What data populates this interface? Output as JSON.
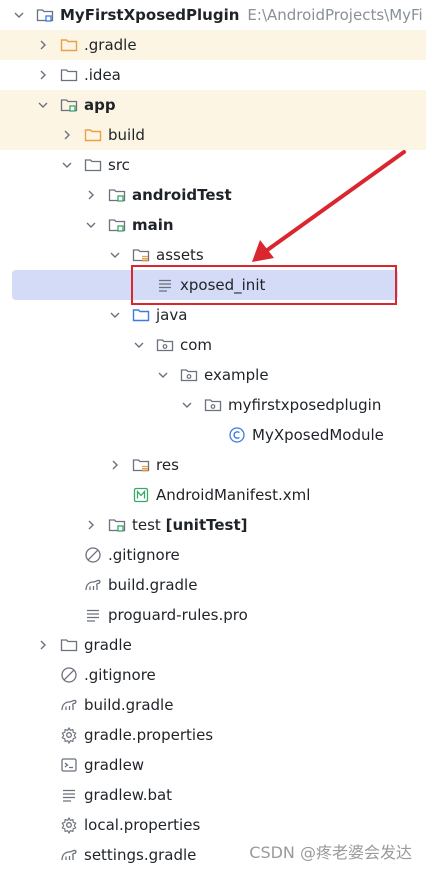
{
  "project": {
    "name": "MyFirstXposedPlugin",
    "path": "E:\\AndroidProjects\\MyFi"
  },
  "nodes": [
    {
      "key": "gradle_dir",
      "label": ".gradle"
    },
    {
      "key": "idea",
      "label": ".idea"
    },
    {
      "key": "app",
      "label": "app"
    },
    {
      "key": "build",
      "label": "build"
    },
    {
      "key": "src",
      "label": "src"
    },
    {
      "key": "androidTest",
      "label": "androidTest"
    },
    {
      "key": "main",
      "label": "main"
    },
    {
      "key": "assets",
      "label": "assets"
    },
    {
      "key": "xposed_init",
      "label": "xposed_init"
    },
    {
      "key": "java",
      "label": "java"
    },
    {
      "key": "com",
      "label": "com"
    },
    {
      "key": "example",
      "label": "example"
    },
    {
      "key": "myfirstxposedplugin",
      "label": "myfirstxposedplugin"
    },
    {
      "key": "module",
      "label": "MyXposedModule"
    },
    {
      "key": "res",
      "label": "res"
    },
    {
      "key": "manifest",
      "label": "AndroidManifest.xml"
    },
    {
      "key": "test",
      "label": "test",
      "extra": "[unitTest]"
    },
    {
      "key": "app_gitignore",
      "label": ".gitignore"
    },
    {
      "key": "app_build_gradle",
      "label": "build.gradle"
    },
    {
      "key": "proguard",
      "label": "proguard-rules.pro"
    },
    {
      "key": "gradle",
      "label": "gradle"
    },
    {
      "key": "root_gitignore",
      "label": ".gitignore"
    },
    {
      "key": "root_build_gradle",
      "label": "build.gradle"
    },
    {
      "key": "gradle_properties",
      "label": "gradle.properties"
    },
    {
      "key": "gradlew",
      "label": "gradlew"
    },
    {
      "key": "gradlew_bat",
      "label": "gradlew.bat"
    },
    {
      "key": "local_properties",
      "label": "local.properties"
    },
    {
      "key": "settings_gradle",
      "label": "settings.gradle"
    }
  ],
  "watermark": "CSDN @疼老婆会发达",
  "colors": {
    "excluded_bg": "#fdf5e3",
    "selected_bg": "#d3dbf6",
    "annotation": "#d9262f",
    "folder_orange": "#e8a04a",
    "folder_blue": "#3d7be0",
    "source_green": "#3aa66b"
  }
}
